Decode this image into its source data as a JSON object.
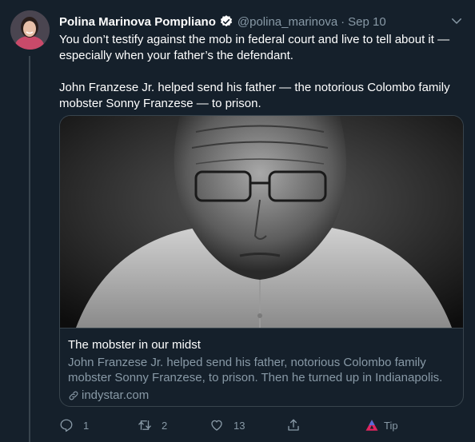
{
  "tweet": {
    "author_name": "Polina Marinova Pompliano",
    "handle": "@polina_marinova",
    "separator": "·",
    "date": "Sep 10",
    "text_para1": "You don’t testify against the mob in federal court and live to tell about it — especially when your father’s the defendant.",
    "text_para2": "John Franzese Jr. helped send his father — the notorious Colombo family mobster Sonny Franzese — to prison."
  },
  "card": {
    "title": "The mobster in our midst",
    "description": "John Franzese Jr. helped send his father, notorious Colombo family mobster Sonny Franzese, to prison. Then he turned up in Indianapolis.",
    "domain": "indystar.com"
  },
  "actions": {
    "reply_count": "1",
    "retweet_count": "2",
    "like_count": "13",
    "tip_label": "Tip"
  },
  "colors": {
    "background": "#15202b",
    "border": "#38444d",
    "secondary_text": "#8899a6",
    "verified": "#1da1f2",
    "tip_red": "#e0245e",
    "tip_blue": "#5a6bd6"
  },
  "icons": [
    "verified-badge-icon",
    "chevron-down-icon",
    "link-icon",
    "reply-icon",
    "retweet-icon",
    "like-icon",
    "share-icon",
    "tip-icon"
  ]
}
